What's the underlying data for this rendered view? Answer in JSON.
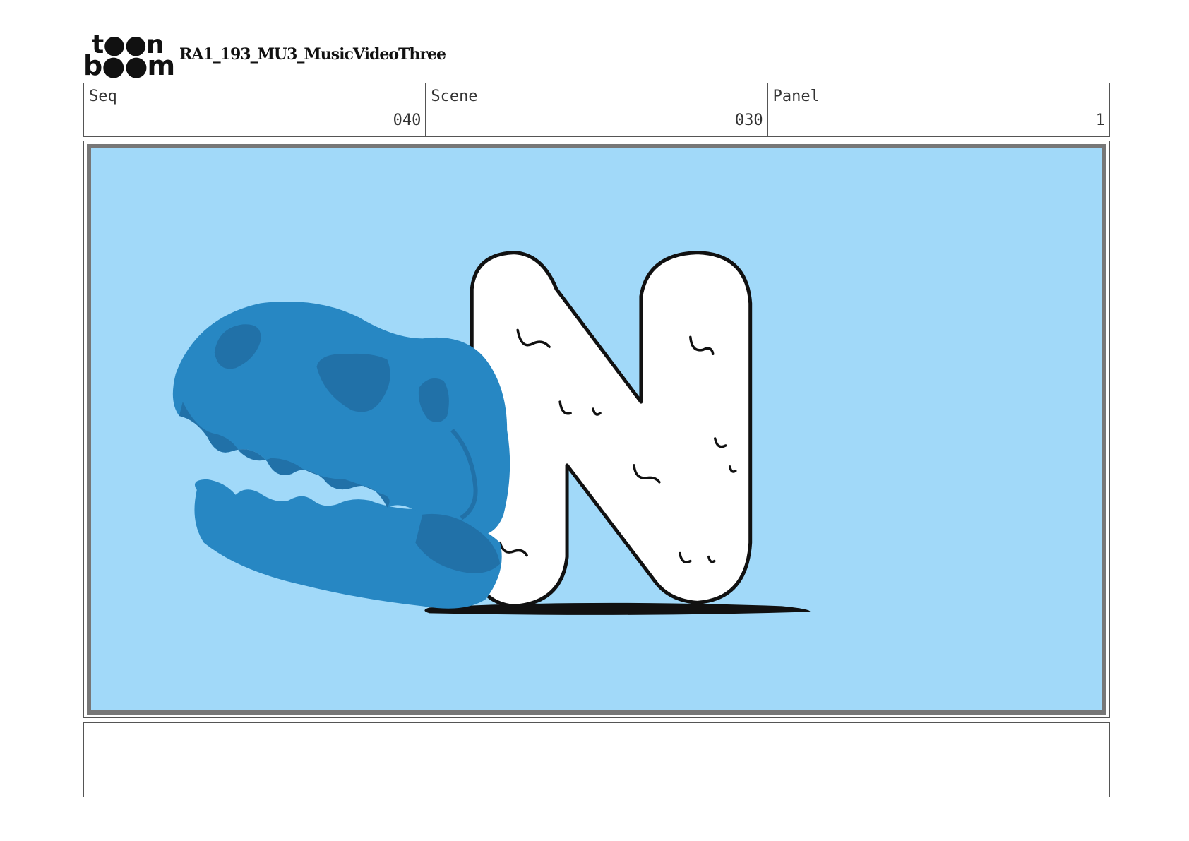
{
  "header": {
    "logo": {
      "line1": "t●●n",
      "line2": "b●●m",
      "brand": "toon boom",
      "icon": "toon-boom-logo"
    },
    "project_title": "RA1_193_MU3_MusicVideoThree"
  },
  "info": {
    "seq_label": "Seq",
    "seq_value": "040",
    "scene_label": "Scene",
    "scene_value": "030",
    "panel_label": "Panel",
    "panel_value": "1"
  },
  "panel": {
    "background_color": "#a1d9f9",
    "skull_color": "#2787c3",
    "skull_shadow_color": "#2171a8",
    "letter_fill": "#ffffff",
    "outline_color": "#111111",
    "artwork": "dinosaur-skull-and-letter-N"
  },
  "notes": {
    "text": ""
  }
}
